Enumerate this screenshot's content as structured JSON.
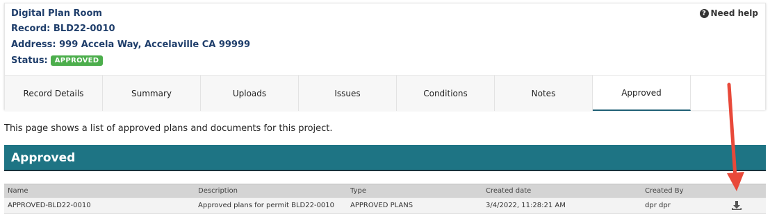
{
  "header": {
    "title": "Digital Plan Room",
    "record": "Record: BLD22-0010",
    "address": "Address: 999 Accela Way, Accelaville CA 99999",
    "status_label": "Status:",
    "status_value": "APPROVED",
    "help_label": "Need help"
  },
  "tabs": [
    {
      "label": "Record Details"
    },
    {
      "label": "Summary"
    },
    {
      "label": "Uploads"
    },
    {
      "label": "Issues"
    },
    {
      "label": "Conditions"
    },
    {
      "label": "Notes"
    },
    {
      "label": "Approved",
      "active": true
    }
  ],
  "intro_text": "This page shows a list of approved plans and documents for this project.",
  "section": {
    "title": "Approved"
  },
  "table": {
    "columns": [
      "Name",
      "Description",
      "Type",
      "Created date",
      "Created By"
    ],
    "rows": [
      {
        "name": "APPROVED-BLD22-0010",
        "description": "Approved plans for permit BLD22-0010",
        "type": "APPROVED PLANS",
        "created_date": "3/4/2022, 11:28:21 AM",
        "created_by": "dpr dpr",
        "action_icon": "download-icon"
      }
    ]
  },
  "colors": {
    "header_text": "#1f3e6b",
    "status_badge": "#4cae4c",
    "section_bar": "#1e7484",
    "annotation_arrow": "#e8493a"
  }
}
